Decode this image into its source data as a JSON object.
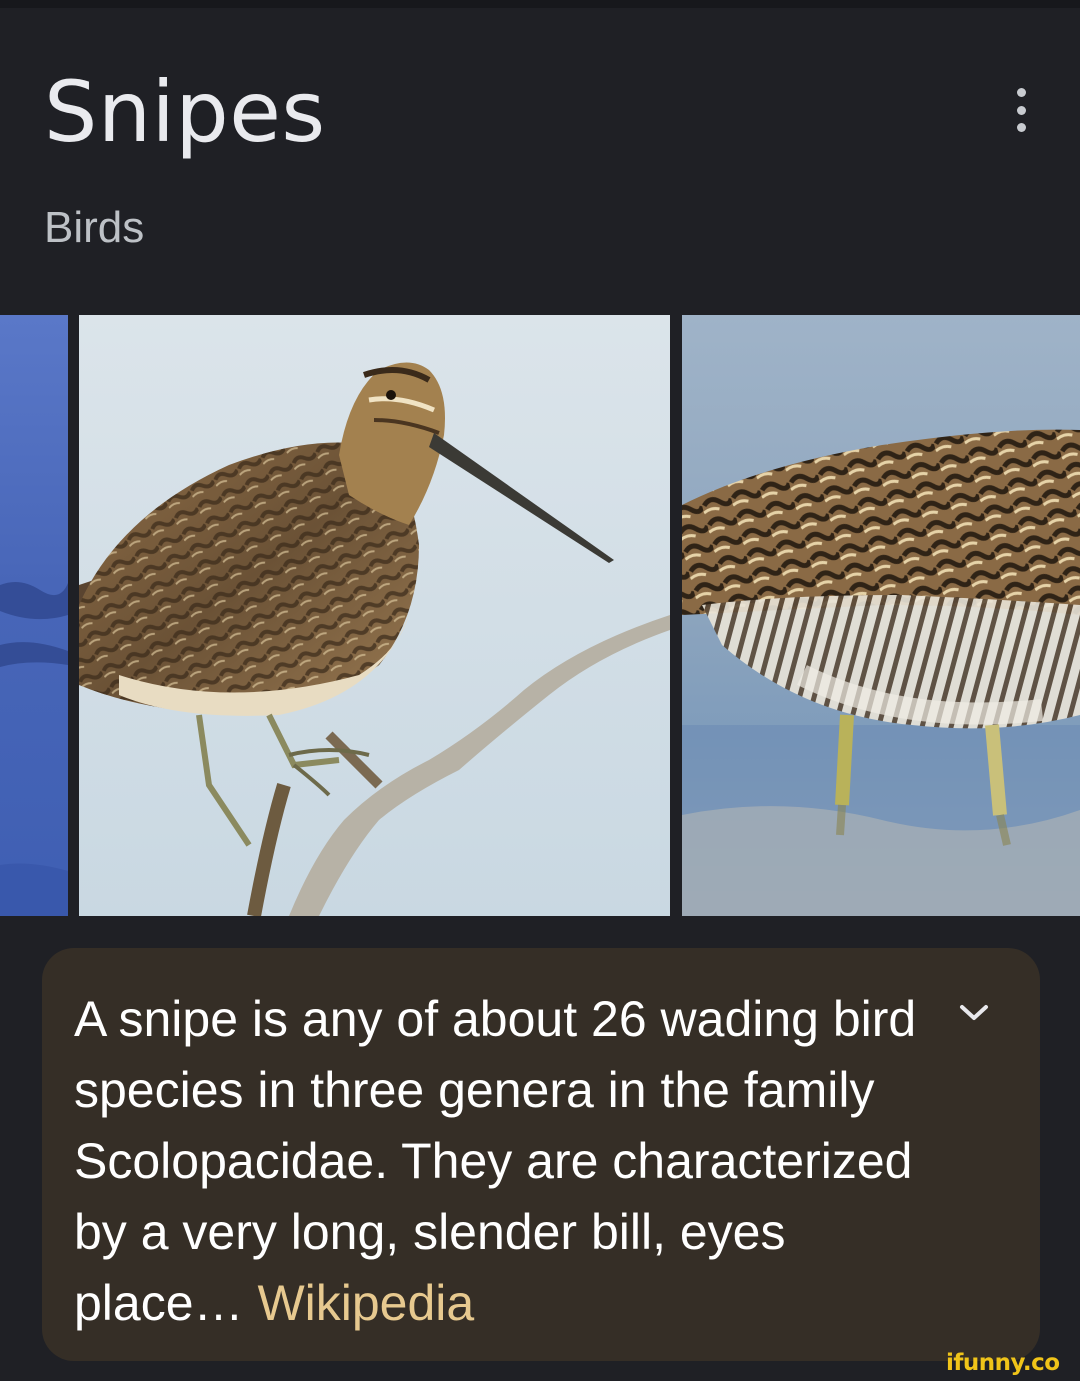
{
  "header": {
    "title": "Snipes",
    "subtitle": "Birds",
    "menu_icon": "more-vertical-icon"
  },
  "gallery": {
    "images": [
      {
        "name": "partial image, blue water"
      },
      {
        "name": "snipe perched on branch"
      },
      {
        "name": "snipe wading in water"
      }
    ]
  },
  "description": {
    "text": "A snipe is any of about 26 wading bird species in three genera in the family Scolopacidae. They are characterized by a very long, slender bill, eyes place… ",
    "source_link": "Wikipedia",
    "expand_icon": "chevron-down-icon"
  },
  "watermark": "ifunny.co",
  "colors": {
    "background": "#1f2025",
    "card": "#352e26",
    "link": "#e7c98f",
    "watermark": "#f0c419"
  }
}
